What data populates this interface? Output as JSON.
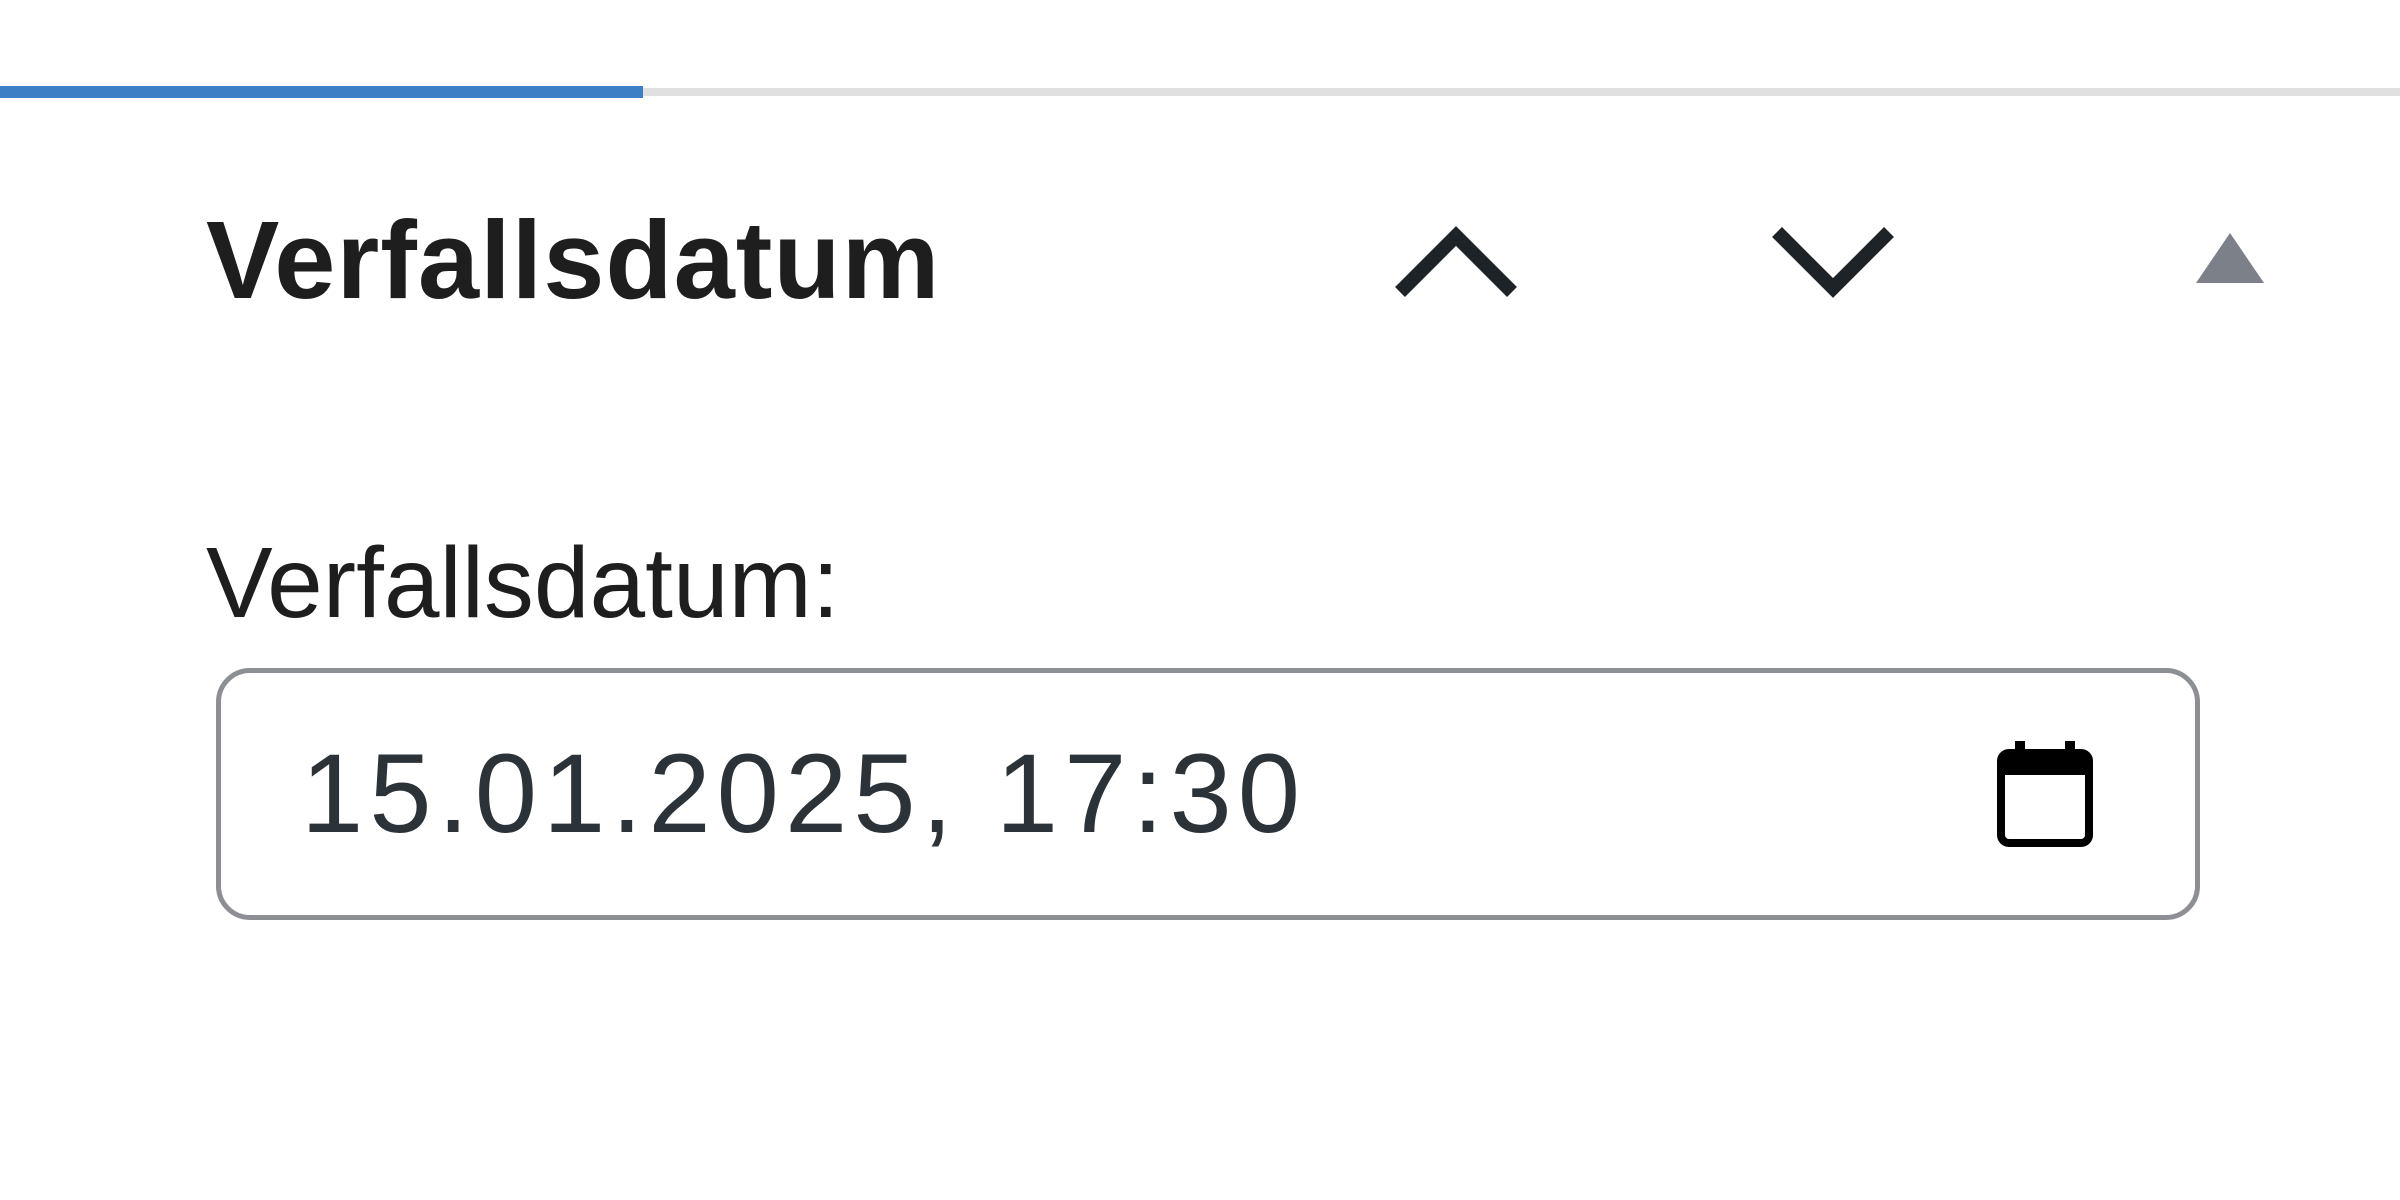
{
  "progress": {
    "percent": 26.8,
    "fill_color": "#3d7fc4",
    "track_color": "#e0e0e0"
  },
  "panel": {
    "title": "Verfallsdatum",
    "controls": {
      "move_up_icon": "chevron-up-icon",
      "move_down_icon": "chevron-down-icon",
      "toggle_icon": "caret-up-icon"
    }
  },
  "field": {
    "label": "Verfallsdatum:",
    "value": "15.01.2025, 17:30",
    "picker_icon": "calendar-icon"
  }
}
